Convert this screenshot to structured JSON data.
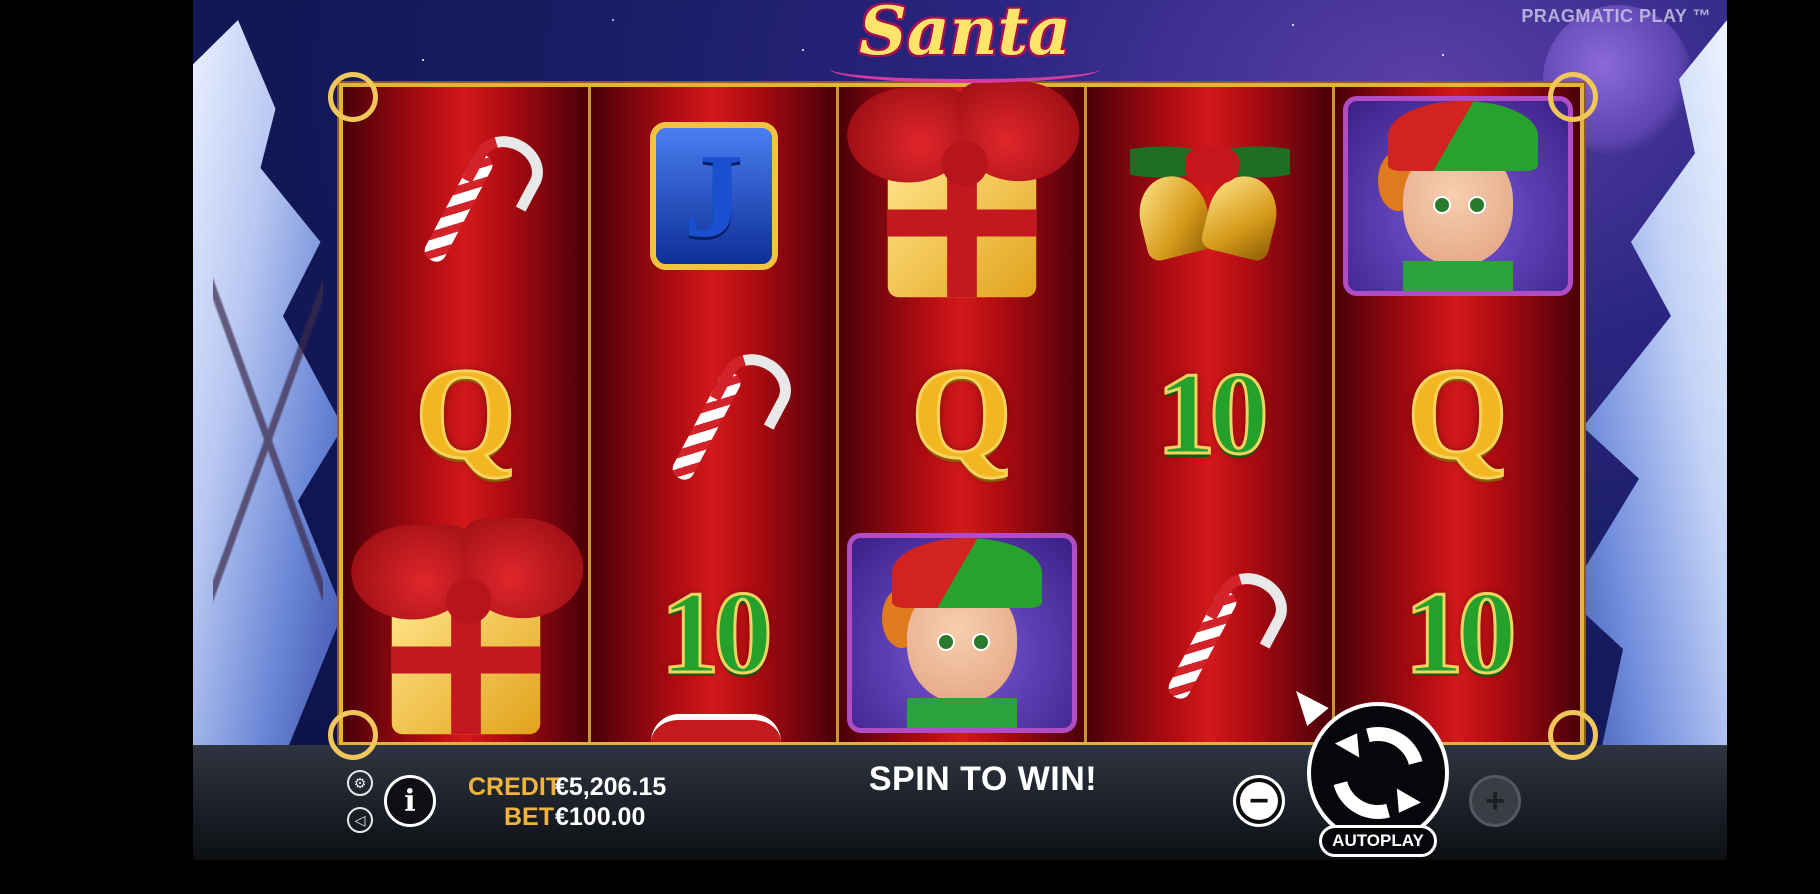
{
  "brand": "PRAGMATIC PLAY ™",
  "logo": {
    "title": "Santa"
  },
  "reels": [
    [
      "candy-cane",
      "Q",
      "gift-box"
    ],
    [
      "J",
      "candy-cane",
      "10"
    ],
    [
      "gift-box",
      "Q",
      "elf"
    ],
    [
      "bells",
      "10",
      "candy-cane"
    ],
    [
      "elf",
      "Q",
      "10"
    ]
  ],
  "symbols": {
    "Q": "Q",
    "J": "J",
    "ten": "10"
  },
  "bottom_bar": {
    "credit_label": "CREDIT",
    "credit_value": "€5,206.15",
    "bet_label": "BET",
    "bet_value": "€100.00",
    "message": "SPIN TO WIN!",
    "info_label": "i",
    "minus_label": "−",
    "plus_label": "+",
    "autoplay_label": "AUTOPLAY",
    "settings_icon": "gear-icon",
    "sound_icon": "speaker-icon"
  },
  "colors": {
    "reel_red": "#d2191b",
    "frame_gold": "#e3b341",
    "credit_orange": "#f2b33a"
  }
}
